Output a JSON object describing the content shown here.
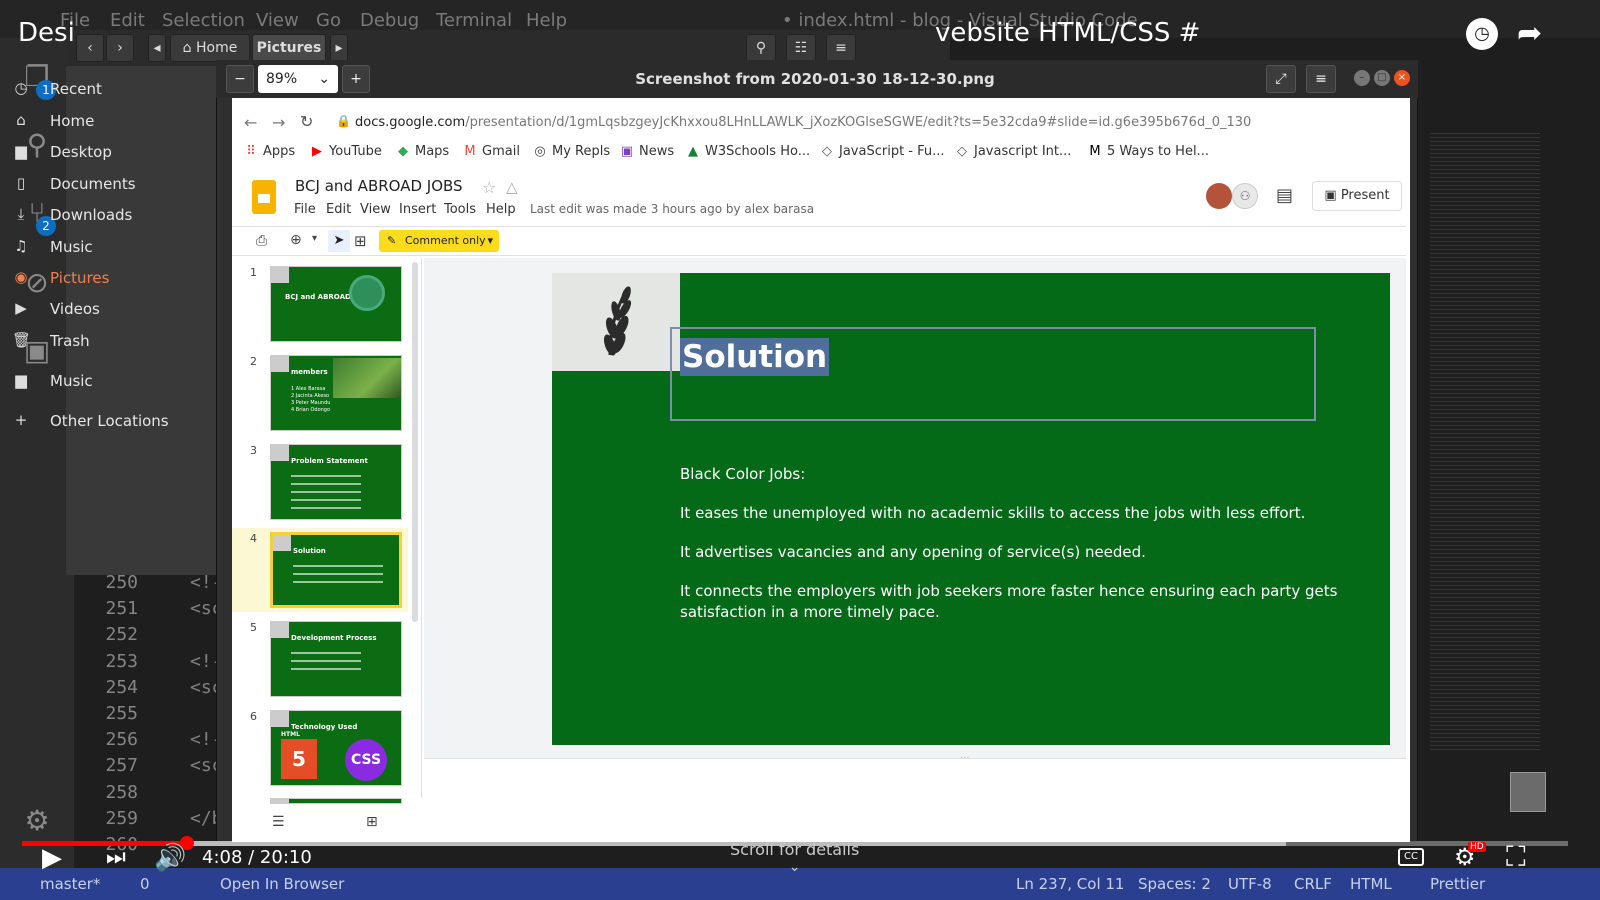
{
  "vscode": {
    "menu": [
      "File",
      "Edit",
      "Selection",
      "View",
      "Go",
      "Debug",
      "Terminal",
      "Help"
    ],
    "window_title": "• index.html - blog - Visual Studio Code",
    "badges": {
      "explorer": "1",
      "source_control": "2"
    },
    "line_numbers": [
      "250",
      "251",
      "252",
      "253",
      "254",
      "255",
      "256",
      "257",
      "258",
      "259",
      "260"
    ],
    "code_lines": [
      "<!-",
      "<sc",
      "",
      "<!-",
      "<sc",
      "",
      "<!-",
      "<sc",
      "",
      "</bod",
      ""
    ],
    "status": {
      "branch": "master*",
      "errors": "0",
      "open_in_browser": "Open In Browser",
      "position": "Ln 237, Col 11",
      "spaces": "Spaces: 2",
      "encoding": "UTF-8",
      "eol": "CRLF",
      "language": "HTML",
      "prettier": "Prettier"
    }
  },
  "youtube": {
    "title_left": "Desi",
    "title_right": "vebsite HTML/CSS #",
    "time": "4:08 / 20:10",
    "scroll_hint": "Scroll for details",
    "played_fraction": 0.2,
    "cc": "CC",
    "hd": "HD"
  },
  "nautilus": {
    "breadcrumb_home": "Home",
    "breadcrumb_current": "Pictures",
    "sidebar": [
      {
        "icon": "clock-icon",
        "glyph": "◷",
        "label": "Recent"
      },
      {
        "icon": "home-icon",
        "glyph": "⌂",
        "label": "Home"
      },
      {
        "icon": "folder-icon",
        "glyph": "▆",
        "label": "Desktop"
      },
      {
        "icon": "document-icon",
        "glyph": "▯",
        "label": "Documents"
      },
      {
        "icon": "download-icon",
        "glyph": "⤓",
        "label": "Downloads"
      },
      {
        "icon": "music-icon",
        "glyph": "♫",
        "label": "Music"
      },
      {
        "icon": "camera-icon",
        "glyph": "◉",
        "label": "Pictures"
      },
      {
        "icon": "video-icon",
        "glyph": "▶",
        "label": "Videos"
      },
      {
        "icon": "trash-icon",
        "glyph": "🗑",
        "label": "Trash"
      },
      {
        "icon": "folder-icon",
        "glyph": "▆",
        "label": "Music"
      },
      {
        "icon": "plus-icon",
        "glyph": "+",
        "label": "Other Locations"
      }
    ],
    "selected": "Pictures"
  },
  "image_viewer": {
    "title": "Screenshot from 2020-01-30 18-12-30.png",
    "zoom": "89%"
  },
  "browser": {
    "url_host": "docs.google.com",
    "url_path": "/presentation/d/1gmLqsbzgeyJcKhxxou8LHnLLAWLK_jXozKOGlseSGWE/edit?ts=5e32cda9#slide=id.g6e395b676d_0_130",
    "bookmarks": [
      {
        "icon": "apps-icon",
        "glyph": "⠿",
        "label": "Apps"
      },
      {
        "icon": "youtube-icon",
        "glyph": "▶",
        "label": "YouTube"
      },
      {
        "icon": "maps-icon",
        "glyph": "◆",
        "label": "Maps"
      },
      {
        "icon": "gmail-icon",
        "glyph": "M",
        "label": "Gmail"
      },
      {
        "icon": "repl-icon",
        "glyph": "◎",
        "label": "My Repls"
      },
      {
        "icon": "news-icon",
        "glyph": "▣",
        "label": "News"
      },
      {
        "icon": "w3schools-icon",
        "glyph": "▲",
        "label": "W3Schools Ho..."
      },
      {
        "icon": "diamond-icon",
        "glyph": "◇",
        "label": "JavaScript - Fu..."
      },
      {
        "icon": "diamond-icon",
        "glyph": "◇",
        "label": "Javascript Int..."
      },
      {
        "icon": "medium-icon",
        "glyph": "M",
        "label": "5 Ways to Hel..."
      }
    ]
  },
  "slides": {
    "doc_title": "BCJ and ABROAD JOBS",
    "menu": [
      "File",
      "Edit",
      "View",
      "Insert",
      "Tools",
      "Help"
    ],
    "last_edit": "Last edit was made 3 hours ago by alex barasa",
    "present": "Present",
    "comment_only": "Comment only",
    "thumbnails": [
      {
        "num": "1",
        "title": "BCJ and ABROAD JOBS"
      },
      {
        "num": "2",
        "title": "members",
        "items": [
          "1  Alex Barasa",
          "2  Jacinta Akeso",
          "3  Peter Maundu",
          "4  Brian Odongo"
        ]
      },
      {
        "num": "3",
        "title": "Problem Statement"
      },
      {
        "num": "4",
        "title": "Solution"
      },
      {
        "num": "5",
        "title": "Development Process"
      },
      {
        "num": "6",
        "title": "Technology Used"
      },
      {
        "num": "7",
        "title": ""
      }
    ],
    "current_slide": {
      "title": "Solution",
      "heading": "Black Color Jobs:",
      "points": [
        "It eases the unemployed with no academic skills to access the jobs with less effort.",
        "It advertises vacancies and any opening of service(s) needed.",
        "It connects the employers with job seekers more faster  hence ensuring each party gets",
        "satisfaction in a more timely pace."
      ]
    },
    "html_badge": "HTML",
    "html_number": "5",
    "css_badge": "CSS"
  }
}
